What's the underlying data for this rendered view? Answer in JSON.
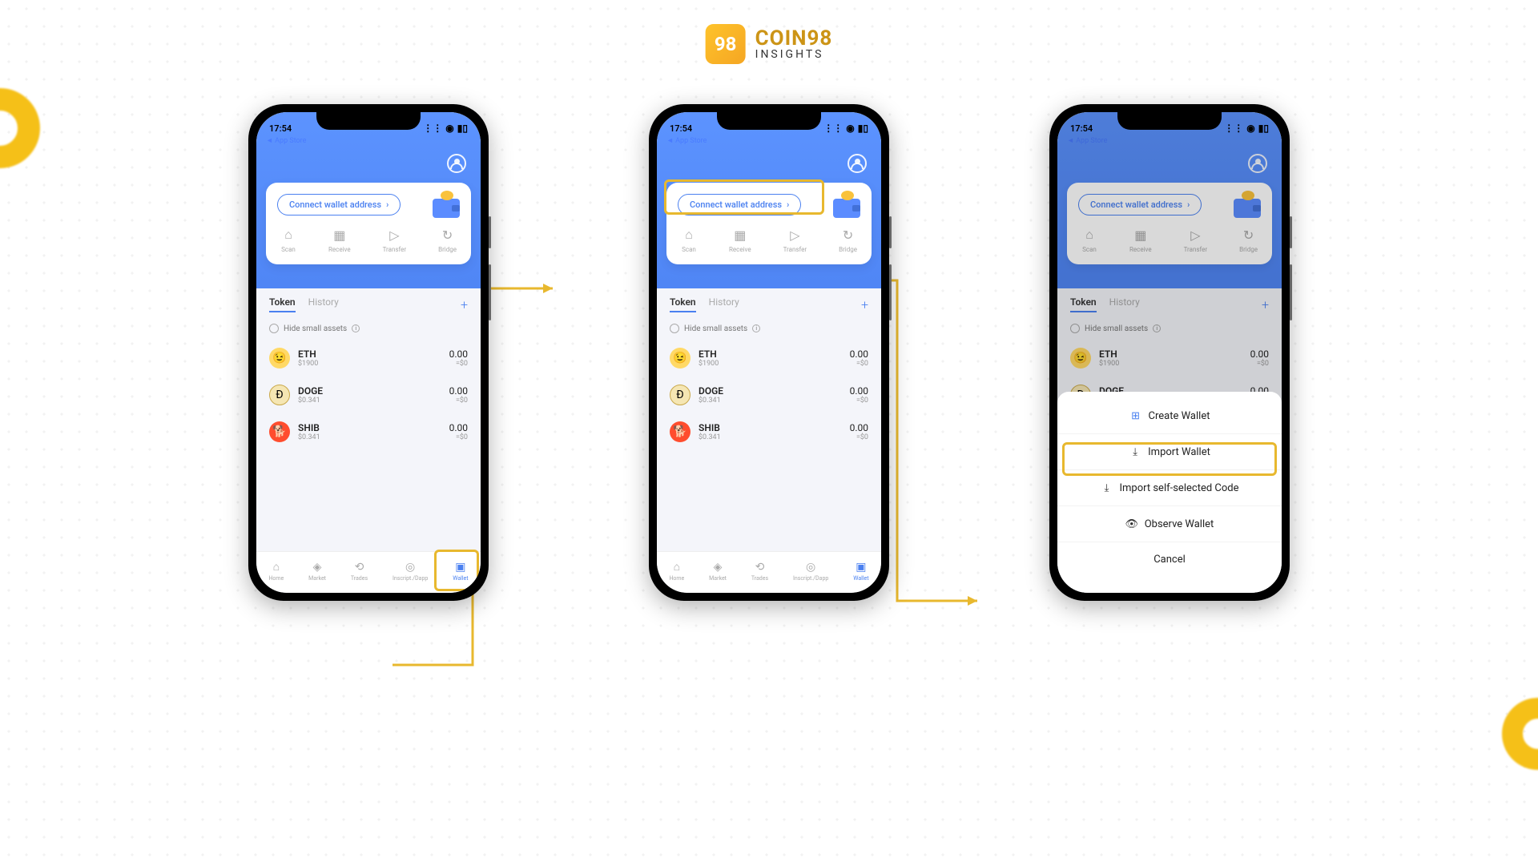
{
  "brand": {
    "main": "COIN98",
    "sub": "INSIGHTS",
    "icon_text": "98"
  },
  "status": {
    "time": "17:54",
    "app_store": "◄ App Store"
  },
  "card": {
    "connect_label": "Connect wallet address"
  },
  "actions": {
    "scan": "Scan",
    "receive": "Receive",
    "transfer": "Transfer",
    "bridge": "Bridge"
  },
  "tabs": {
    "token": "Token",
    "history": "History"
  },
  "hide_label": "Hide small assets",
  "tokens": [
    {
      "name": "ETH",
      "price": "$1900",
      "amount": "0.00",
      "value": "=$0"
    },
    {
      "name": "DOGE",
      "price": "$0.341",
      "amount": "0.00",
      "value": "=$0"
    },
    {
      "name": "SHIB",
      "price": "$0.341",
      "amount": "0.00",
      "value": "=$0"
    }
  ],
  "nav": {
    "home": "Home",
    "market": "Market",
    "trades": "Trades",
    "inscript": "Inscript./Dapp",
    "wallet": "Wallet"
  },
  "sheet": {
    "create": "Create Wallet",
    "import": "Import Wallet",
    "import_code": "Import self-selected Code",
    "observe": "Observe Wallet",
    "cancel": "Cancel"
  }
}
